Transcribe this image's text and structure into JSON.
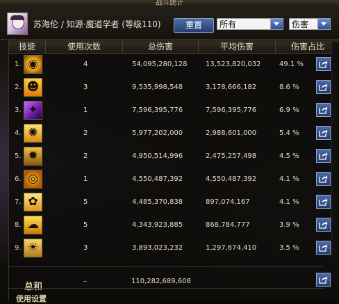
{
  "window": {
    "title": "战斗统计"
  },
  "header": {
    "character": "苏海伦 / 知源·魔道学者 (等级110)",
    "reset_label": "重置",
    "filter_select": "所有",
    "metric_select": "伤害"
  },
  "columns": [
    "技能",
    "使用次数",
    "总伤害",
    "平均伤害",
    "伤害占比"
  ],
  "rows": [
    {
      "idx": "1.",
      "icon": "skill-icon-1",
      "uses": "4",
      "total": "54,095,280,128",
      "avg": "13,523,820,032",
      "pct": "49.1 %"
    },
    {
      "idx": "2.",
      "icon": "skill-icon-2",
      "uses": "3",
      "total": "9,535,998,548",
      "avg": "3,178,666,182",
      "pct": "8.6 %"
    },
    {
      "idx": "3.",
      "icon": "skill-icon-3",
      "uses": "1",
      "total": "7,596,395,776",
      "avg": "7,596,395,776",
      "pct": "6.9 %"
    },
    {
      "idx": "4.",
      "icon": "skill-icon-4",
      "uses": "2",
      "total": "5,977,202,000",
      "avg": "2,988,601,000",
      "pct": "5.4 %"
    },
    {
      "idx": "5.",
      "icon": "skill-icon-5",
      "uses": "2",
      "total": "4,950,514,996",
      "avg": "2,475,257,498",
      "pct": "4.5 %"
    },
    {
      "idx": "6.",
      "icon": "skill-icon-6",
      "uses": "1",
      "total": "4,550,487,392",
      "avg": "4,550,487,392",
      "pct": "4.1 %"
    },
    {
      "idx": "7.",
      "icon": "skill-icon-7",
      "uses": "5",
      "total": "4,485,370,838",
      "avg": "897,074,167",
      "pct": "4.1 %"
    },
    {
      "idx": "8.",
      "icon": "skill-icon-8",
      "uses": "5",
      "total": "4,343,923,885",
      "avg": "868,784,777",
      "pct": "3.9 %"
    },
    {
      "idx": "9.",
      "icon": "skill-icon-9",
      "uses": "3",
      "total": "3,893,023,232",
      "avg": "1,297,674,410",
      "pct": "3.5 %"
    }
  ],
  "total": {
    "label": "总和",
    "uses": "–",
    "total": "110,282,689,608"
  },
  "usage_settings": "使用设置",
  "colors": {
    "accent": "#3a5a9a",
    "border": "#4a4130",
    "text": "#e3dccb"
  }
}
